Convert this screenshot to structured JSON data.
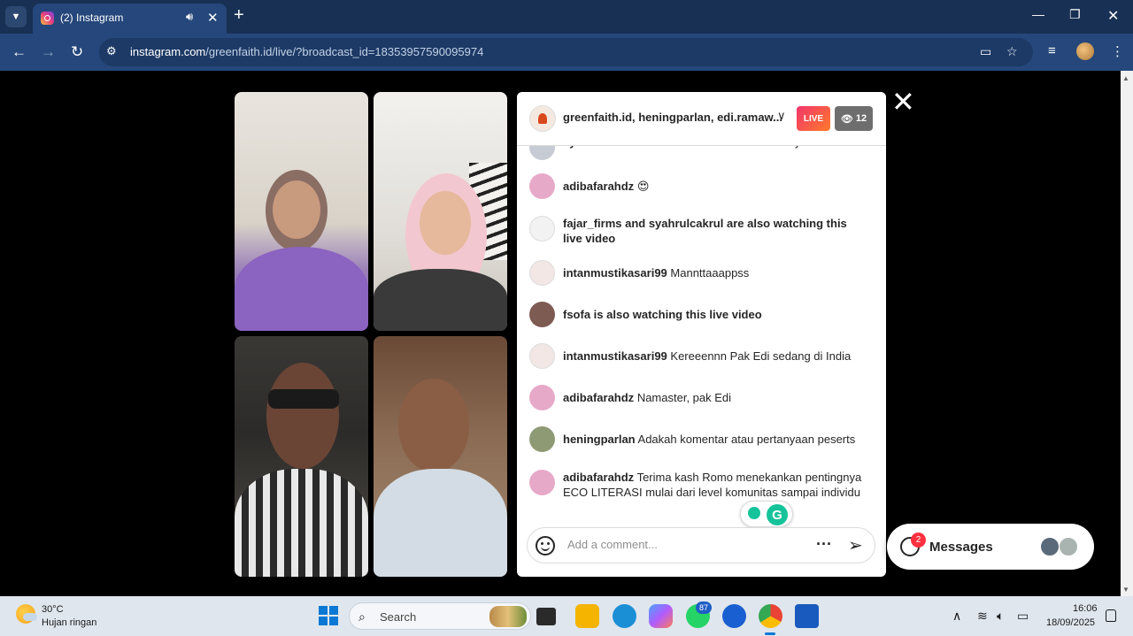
{
  "browser": {
    "tab": {
      "title": "(2) Instagram"
    },
    "url": {
      "host": "instagram.com",
      "path": "/greenfaith.id/live/?broadcast_id=18353957590095974"
    }
  },
  "live": {
    "host_names": "greenfaith.id, heningparlan, edi.ramaw...",
    "live_label": "LIVE",
    "viewer_count": "12",
    "partial_comment": {
      "user": "syahrulcakrul",
      "text": "Yakin bakal keren nih diskusinya"
    },
    "comments": [
      {
        "user": "adibafarahdz",
        "text": "😍",
        "color": "#e7a9c8"
      },
      {
        "user": "",
        "text": "fajar_firms and syahrulcakrul are also watching this live video",
        "color": "#f2f2f2"
      },
      {
        "user": "intanmustikasari99",
        "text": "Mannttaaappss",
        "color": "#f3e7e5"
      },
      {
        "user": "",
        "text": "fsofa is also watching this live video",
        "color": "#7d5a52"
      },
      {
        "user": "intanmustikasari99",
        "text": "Kereeennn Pak Edi sedang di India",
        "color": "#f3e7e5"
      },
      {
        "user": "adibafarahdz",
        "text": "Namaster, pak Edi",
        "color": "#e7a9c8"
      },
      {
        "user": "heningparlan",
        "text": "Adakah komentar atau pertanyaan peserts",
        "color": "#8e9a74"
      },
      {
        "user": "adibafarahdz",
        "text": "Terima kash Romo menekankan pentingnya ECO LITERASI mulai dari level komunitas sampai individu",
        "color": "#e7a9c8"
      }
    ],
    "comment_placeholder": "Add a comment..."
  },
  "messages": {
    "label": "Messages",
    "badge": "2"
  },
  "taskbar": {
    "weather_temp": "30°C",
    "weather_desc": "Hujan ringan",
    "search_label": "Search",
    "whatsapp_badge": "87",
    "time": "16:06",
    "date": "18/09/2025"
  }
}
